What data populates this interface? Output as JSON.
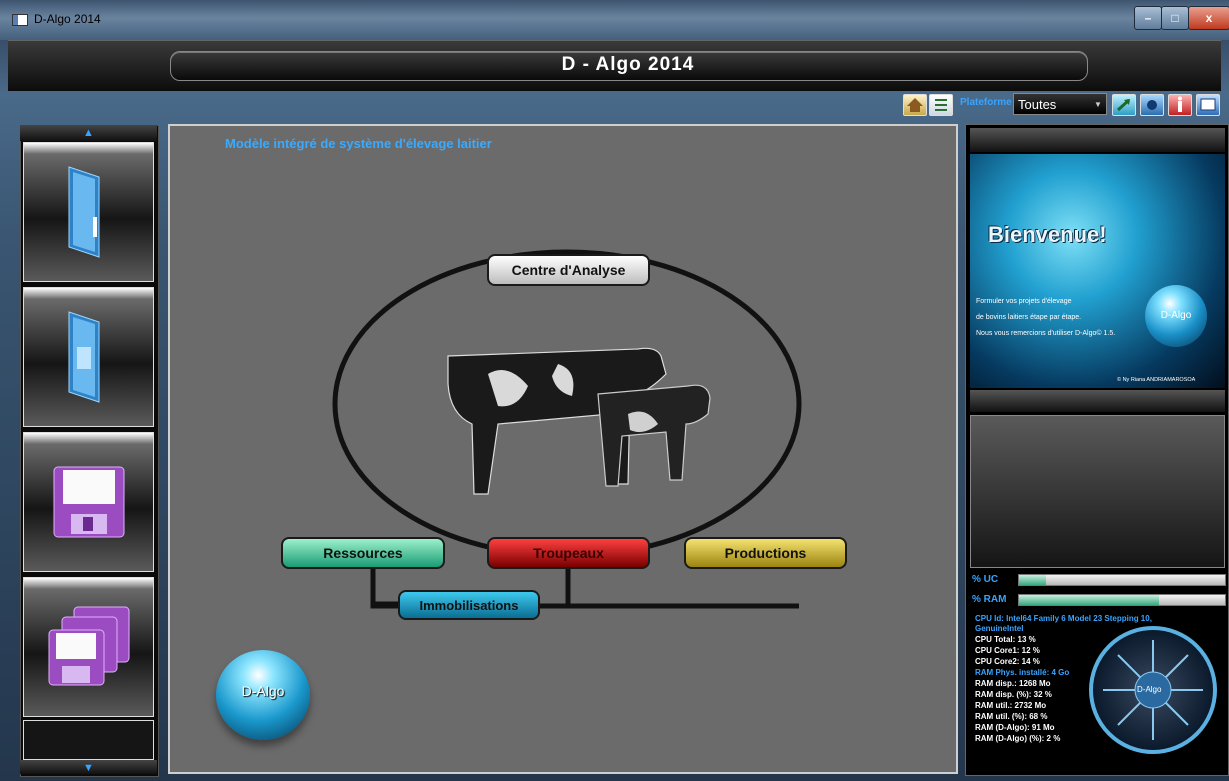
{
  "window": {
    "title": "D-Algo 2014",
    "min": "–",
    "max": "□",
    "close": "x"
  },
  "header": {
    "title": "D - Algo 2014"
  },
  "toolbar": {
    "label": "Plateforme",
    "select_value": "Toutes"
  },
  "center": {
    "title": "Modèle intégré de système d'élevage laitier",
    "nodes": {
      "centre": "Centre d'Analyse",
      "ressources": "Ressources",
      "troupeaux": "Troupeaux",
      "productions": "Productions",
      "immobilisations": "Immobilisations"
    },
    "logo": "D-Algo"
  },
  "welcome": {
    "title": "Bienvenue!",
    "line1": "Formuler vos projets d'élevage",
    "line2": "de bovins laitiers étape par étape.",
    "line3": "Nous vous remercions d'utiliser D-Algo© 1.5.",
    "credit": "© Ny Riana ANDRIAMAROSOA",
    "logo": "D-Algo"
  },
  "system": {
    "uc_label": "% UC",
    "ram_label": "% RAM",
    "uc_percent": 13,
    "ram_percent": 68,
    "cpu_id": "CPU Id: Intel64 Family 6 Model 23 Stepping 10,",
    "cpu_vendor": "GenuineIntel",
    "cpu_total": "CPU Total: 13 %",
    "cpu_core1": "CPU Core1: 12 %",
    "cpu_core2": "CPU Core2: 14 %",
    "ram_phys": "RAM Phys. installé: 4 Go",
    "ram_disp": "RAM disp.: 1268 Mo",
    "ram_disp_pct": "RAM disp. (%): 32 %",
    "ram_util": "RAM util.: 2732 Mo",
    "ram_util_pct": "RAM util. (%): 68 %",
    "ram_dalgo": "RAM (D-Algo): 91 Mo",
    "ram_dalgo_pct": "RAM (D-Algo) (%): 2 %",
    "fan_label": "D-Algo"
  },
  "icons": {
    "toolbar": [
      "home-icon",
      "checklist-icon",
      "export-icon",
      "settings-icon",
      "info-icon",
      "display-icon"
    ],
    "sidebar": [
      "new-project-folder-icon",
      "open-project-folder-icon",
      "save-disk-icon",
      "save-as-disks-icon"
    ]
  },
  "colors": {
    "accent": "#39a4ff",
    "ressources": "#1b9c74",
    "troupeaux": "#b00000",
    "productions": "#c0a420",
    "immobilisations": "#0a88b0"
  }
}
